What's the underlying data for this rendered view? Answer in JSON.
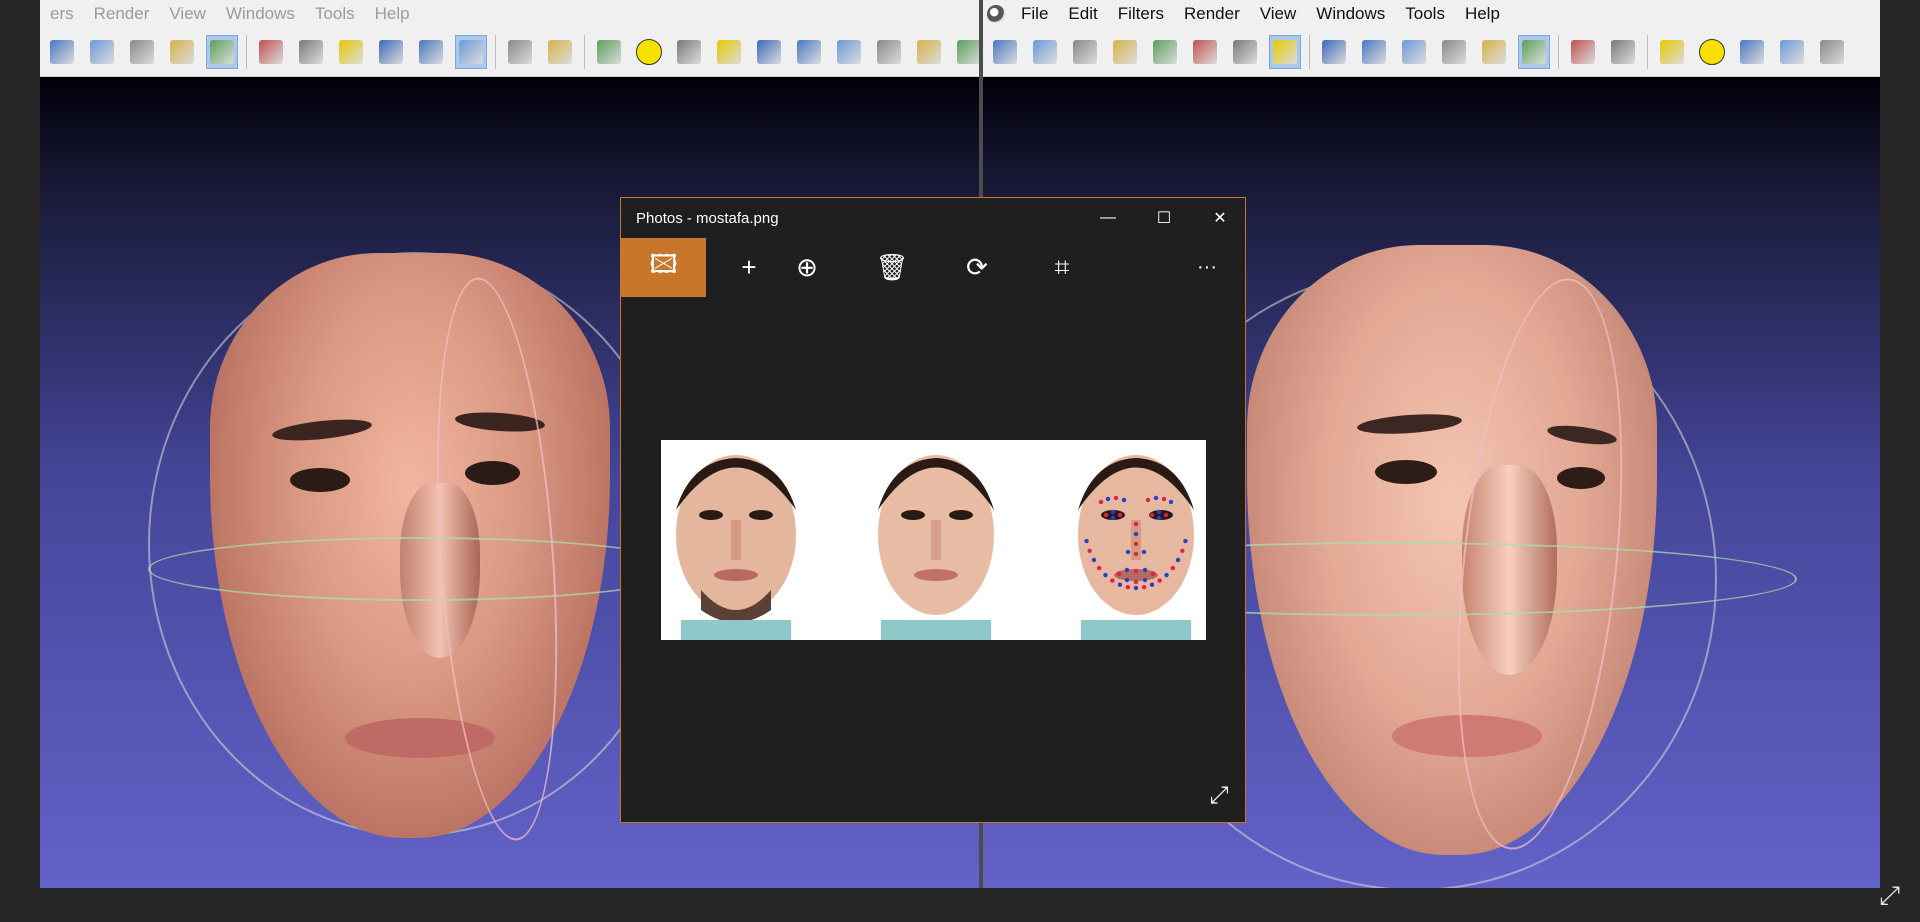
{
  "left_window": {
    "menu": [
      "ers",
      "Render",
      "View",
      "Windows",
      "Tools",
      "Help"
    ]
  },
  "right_window": {
    "menu": [
      "File",
      "Edit",
      "Filters",
      "Render",
      "View",
      "Windows",
      "Tools",
      "Help"
    ]
  },
  "toolbar_icons_left": [
    "rotate-icon",
    "refresh-icon",
    "mesh-icon",
    "snapshot-icon",
    "layers-icon",
    "sphere-icon",
    "bbox-icon",
    "points-icon",
    "wireframe-icon",
    "flat-icon",
    "smooth-icon",
    "layer-stack-icon",
    "axes-icon",
    "globe-icon",
    "annotation-a-icon",
    "xyz-axes-icon",
    "color-ball-icon",
    "camera-align-icon",
    "brush-icon",
    "pickpoints-icon",
    "measure-icon",
    "lasso-icon",
    "color-paint-icon"
  ],
  "toolbar_icons_right": [
    "new-file-icon",
    "open-folder-icon",
    "open-project-icon",
    "rotate-icon",
    "refresh-icon",
    "mesh-icon",
    "snapshot-icon",
    "layers-icon",
    "sphere-icon",
    "bbox-icon",
    "points-icon",
    "wireframe-icon",
    "flat-icon",
    "smooth-icon",
    "layer-stack-icon",
    "axes-icon",
    "globe-icon",
    "annotation-a-icon",
    "xyz-axes-icon",
    "color-ball-icon",
    "camera-align-icon"
  ],
  "photos": {
    "title": "Photos - mostafa.png",
    "minimize": "—",
    "maximize": "☐",
    "close": "✕",
    "toolbar": {
      "image": "🖾",
      "add": "+",
      "zoom": "⊕",
      "delete": "🗑",
      "rotate": "⟳",
      "crop": "⌗",
      "more": "···"
    },
    "expand": "⤢"
  },
  "screen_expand": "⤢",
  "colors": {
    "accent": "#c7762a",
    "viewport_top": "#00000a",
    "viewport_bottom": "#6262c8",
    "landmark_blue": "#2a3bd6",
    "landmark_red": "#e0204a"
  }
}
